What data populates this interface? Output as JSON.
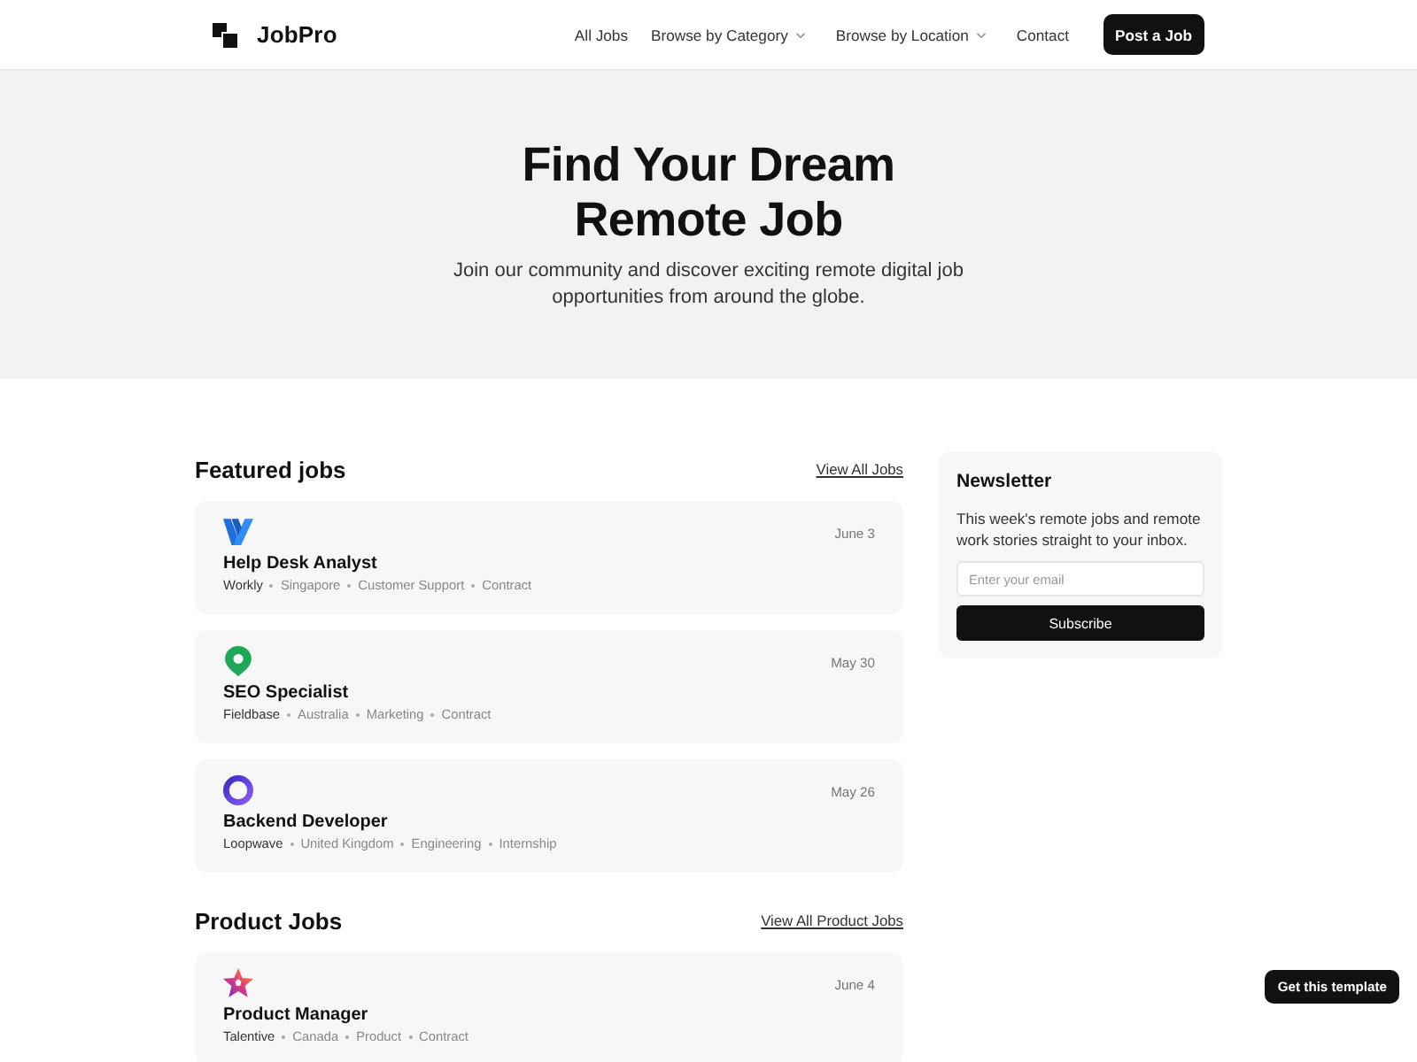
{
  "header": {
    "logo": "JobPro",
    "nav": [
      {
        "label": "All Jobs",
        "kind": "link"
      },
      {
        "label": "Browse by Category",
        "kind": "dropdown"
      },
      {
        "label": "Browse by Location",
        "kind": "dropdown"
      },
      {
        "label": "Contact",
        "kind": "link"
      }
    ],
    "cta": "Post a Job"
  },
  "hero": {
    "title": "Find Your Dream Remote Job",
    "subtitle": "Join our community and discover exciting remote digital job opportunities from around the globe."
  },
  "sections": [
    {
      "title": "Featured jobs",
      "link": "View All Jobs",
      "jobs": [
        {
          "kind": "chevron",
          "title": "Help Desk Analyst",
          "date": "June 3",
          "company": "Workly",
          "tags": [
            "Singapore",
            "Customer Support",
            "Contract"
          ]
        },
        {
          "kind": "pin",
          "title": "SEO Specialist",
          "date": "May 30",
          "company": "Fieldbase",
          "tags": [
            "Australia",
            "Marketing",
            "Contract"
          ]
        },
        {
          "kind": "ring",
          "title": "Backend Developer",
          "date": "May 26",
          "company": "Loopwave",
          "tags": [
            "United Kingdom",
            "Engineering",
            "Internship"
          ]
        }
      ]
    },
    {
      "title": "Product Jobs",
      "link": "View All Product Jobs",
      "jobs": [
        {
          "kind": "star",
          "title": "Product Manager",
          "date": "June 4",
          "company": "Talentive",
          "tags": [
            "Canada",
            "Product",
            "Contract"
          ]
        }
      ]
    }
  ],
  "newsletter": {
    "title": "Newsletter",
    "text": "This week's remote jobs and remote work stories straight to your inbox.",
    "placeholder": "Enter your email",
    "button": "Subscribe"
  },
  "floating_button": "Get this template"
}
